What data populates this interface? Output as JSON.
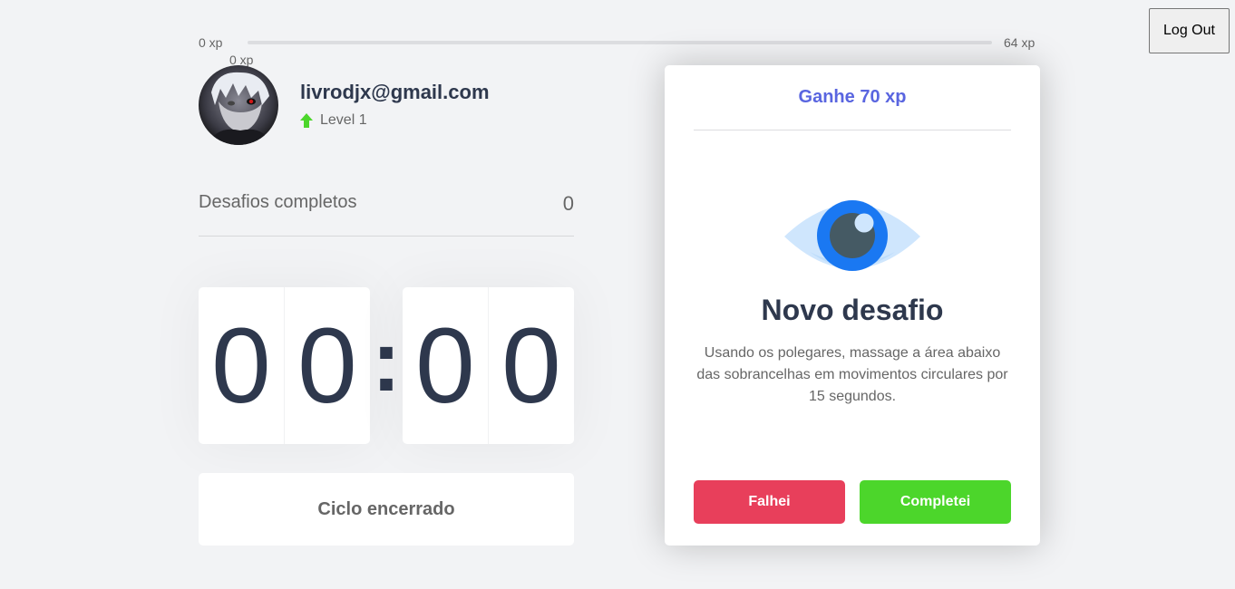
{
  "header": {
    "logout_label": "Log Out"
  },
  "xp_bar": {
    "start_label": "0 xp",
    "end_label": "64 xp",
    "current_label": "0 xp",
    "progress_percent": 0
  },
  "profile": {
    "email": "livrodjx@gmail.com",
    "level_label": "Level 1",
    "avatar_icon": "avatar-image",
    "level_icon": "level-up-arrow-icon"
  },
  "completed": {
    "label": "Desafios completos",
    "count": "0"
  },
  "countdown": {
    "minute_left": "0",
    "minute_right": "0",
    "separator": ":",
    "second_left": "0",
    "second_right": "0"
  },
  "cycle_button": {
    "label": "Ciclo encerrado"
  },
  "challenge": {
    "xp_label": "Ganhe 70 xp",
    "icon": "eye-icon",
    "title": "Novo desafio",
    "description": "Usando os polegares, massage a área abaixo das sobrancelhas em movimentos circulares por 15 segundos.",
    "fail_label": "Falhei",
    "complete_label": "Completei"
  },
  "colors": {
    "background": "#f2f3f5",
    "text": "#666666",
    "title": "#2e384d",
    "blue": "#5965e0",
    "green": "#4cd62b",
    "red": "#e83f5b"
  }
}
